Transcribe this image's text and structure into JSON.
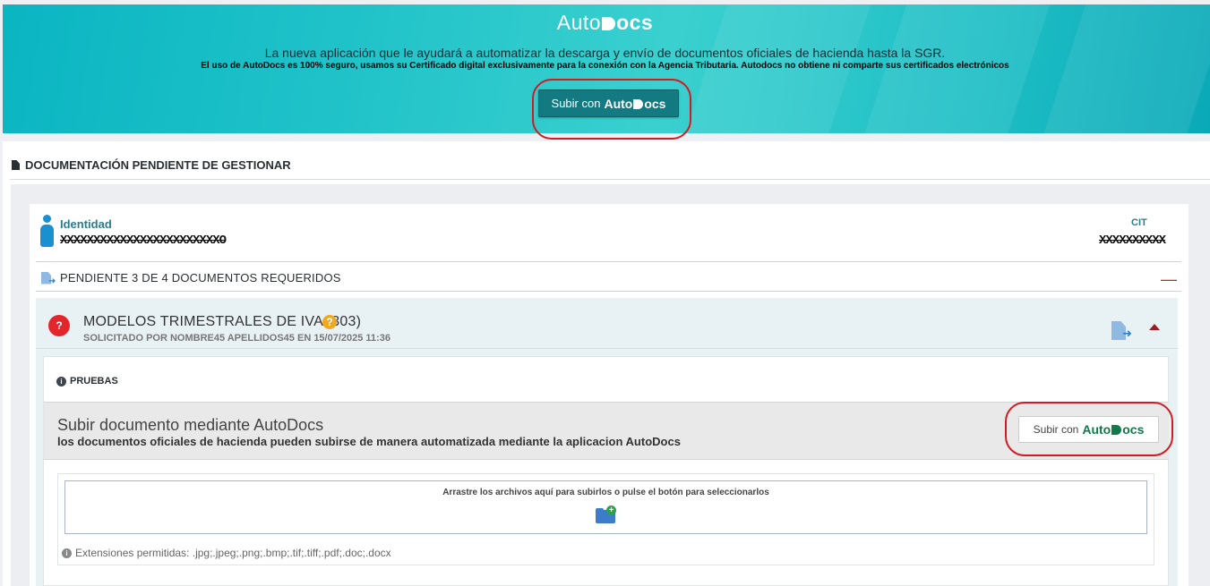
{
  "banner": {
    "brand_plain": "Auto",
    "brand_strong": "ocs",
    "lead": "La nueva aplicación que le ayudará a automatizar la descarga y envío de documentos oficiales de hacienda hasta la SGR.",
    "fine": "El uso de AutoDocs es 100% seguro, usamos su Certificado digital exclusivamente para la conexión con la Agencia Tributaria. Autodocs no obtiene ni comparte sus certificados electrónicos",
    "button_prefix": "Subir con",
    "button_brand_plain": "Auto",
    "button_brand_strong": "ocs"
  },
  "section": {
    "title": "DOCUMENTACIÓN PENDIENTE DE GESTIONAR"
  },
  "identity": {
    "label": "Identidad",
    "value": "XXXXXXXXXXXXXXXXXXXXXXXXO",
    "cit_label": "CIT",
    "cit_value": "XXXXXXXXXX"
  },
  "pending": {
    "label": "PENDIENTE 3 DE 4 DOCUMENTOS REQUERIDOS",
    "collapse_symbol": "—"
  },
  "model": {
    "badge": "?",
    "title": "MODELOS TRIMESTRALES DE IVA (303)",
    "help_symbol": "?",
    "subtitle": "SOLICITADO POR NOMBRE45 APELLIDOS45 EN 15/07/2025 11:36",
    "note_label": "PRUEBAS",
    "info_symbol": "i"
  },
  "upload": {
    "title": "Subir documento mediante AutoDocs",
    "description": "los documentos oficiales de hacienda pueden subirse de manera automatizada mediante la aplicacion AutoDocs",
    "button_prefix": "Subir con",
    "button_brand_plain": "Auto",
    "button_brand_strong": "ocs",
    "dropzone_text": "Arrastre los archivos aquí para subirlos o pulse el botón para seleccionarlos",
    "folder_plus": "+",
    "extensions": "Extensiones permitidas: .jpg;.jpeg;.png;.bmp;.tif;.tiff;.pdf;.doc;.docx"
  },
  "colors": {
    "banner_teal": "#21c3c9",
    "button_teal": "#137a82",
    "brand_green": "#0f7a4a",
    "highlight_red": "#d01b24",
    "person_blue": "#1a90d0"
  },
  "icons": {
    "person": "person-icon",
    "file_send": "file-send-icon",
    "pdf": "pdf-icon",
    "help": "help-icon",
    "info": "info-icon",
    "folder_add": "folder-add-icon",
    "caret_up": "caret-up-icon"
  }
}
